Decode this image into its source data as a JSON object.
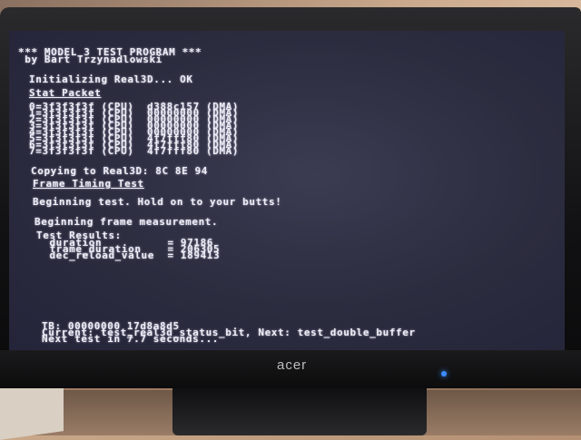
{
  "terminal": {
    "lines": [
      "*** MODEL 3 TEST PROGRAM ***",
      " by Bart Trzynadlowski",
      "",
      "Initializing Real3D... OK",
      "Stat Packet",
      "0=3f3f3f3f (CPU)  d388c157 (DMA)",
      "1=3f3f3f3f (CPU)  00000000 (DMA)",
      "2=3f3f3f3f (CPU)  00000000 (DMA)",
      "3=3f3f3f3f (CPU)  00000000 (DMA)",
      "4=3f3f3f3f (CPU)  00000000 (DMA)",
      "5=3f3f3f3f (CPU)  4f7fff80 (DMA)",
      "6=3f3f3f3f (CPU)  4f7fff80 (DMA)",
      "7=3f3f3f3f (CPU)  4f7fff80 (DMA)",
      "",
      "Copying to Real3D: 8C 8E 94",
      "",
      "Frame Timing Test",
      "",
      "Beginning test. Hold on to your butts!",
      "",
      "Beginning frame measurement.",
      "",
      "Test Results:",
      "  duration          = 97186",
      "  frame_duration    = 206305",
      "  dec_reload_value  = 189413",
      "TB: 00000000 17d8a8d5",
      "Current: test_real3d_status_bit, Next: test_double_buffer",
      "Next test in 7.7 seconds..."
    ]
  },
  "monitor": {
    "brand": "acer"
  },
  "colors": {
    "screen_bg": "#2c2c3f",
    "text": "#eeeef6",
    "power_led": "#3a8cff"
  }
}
